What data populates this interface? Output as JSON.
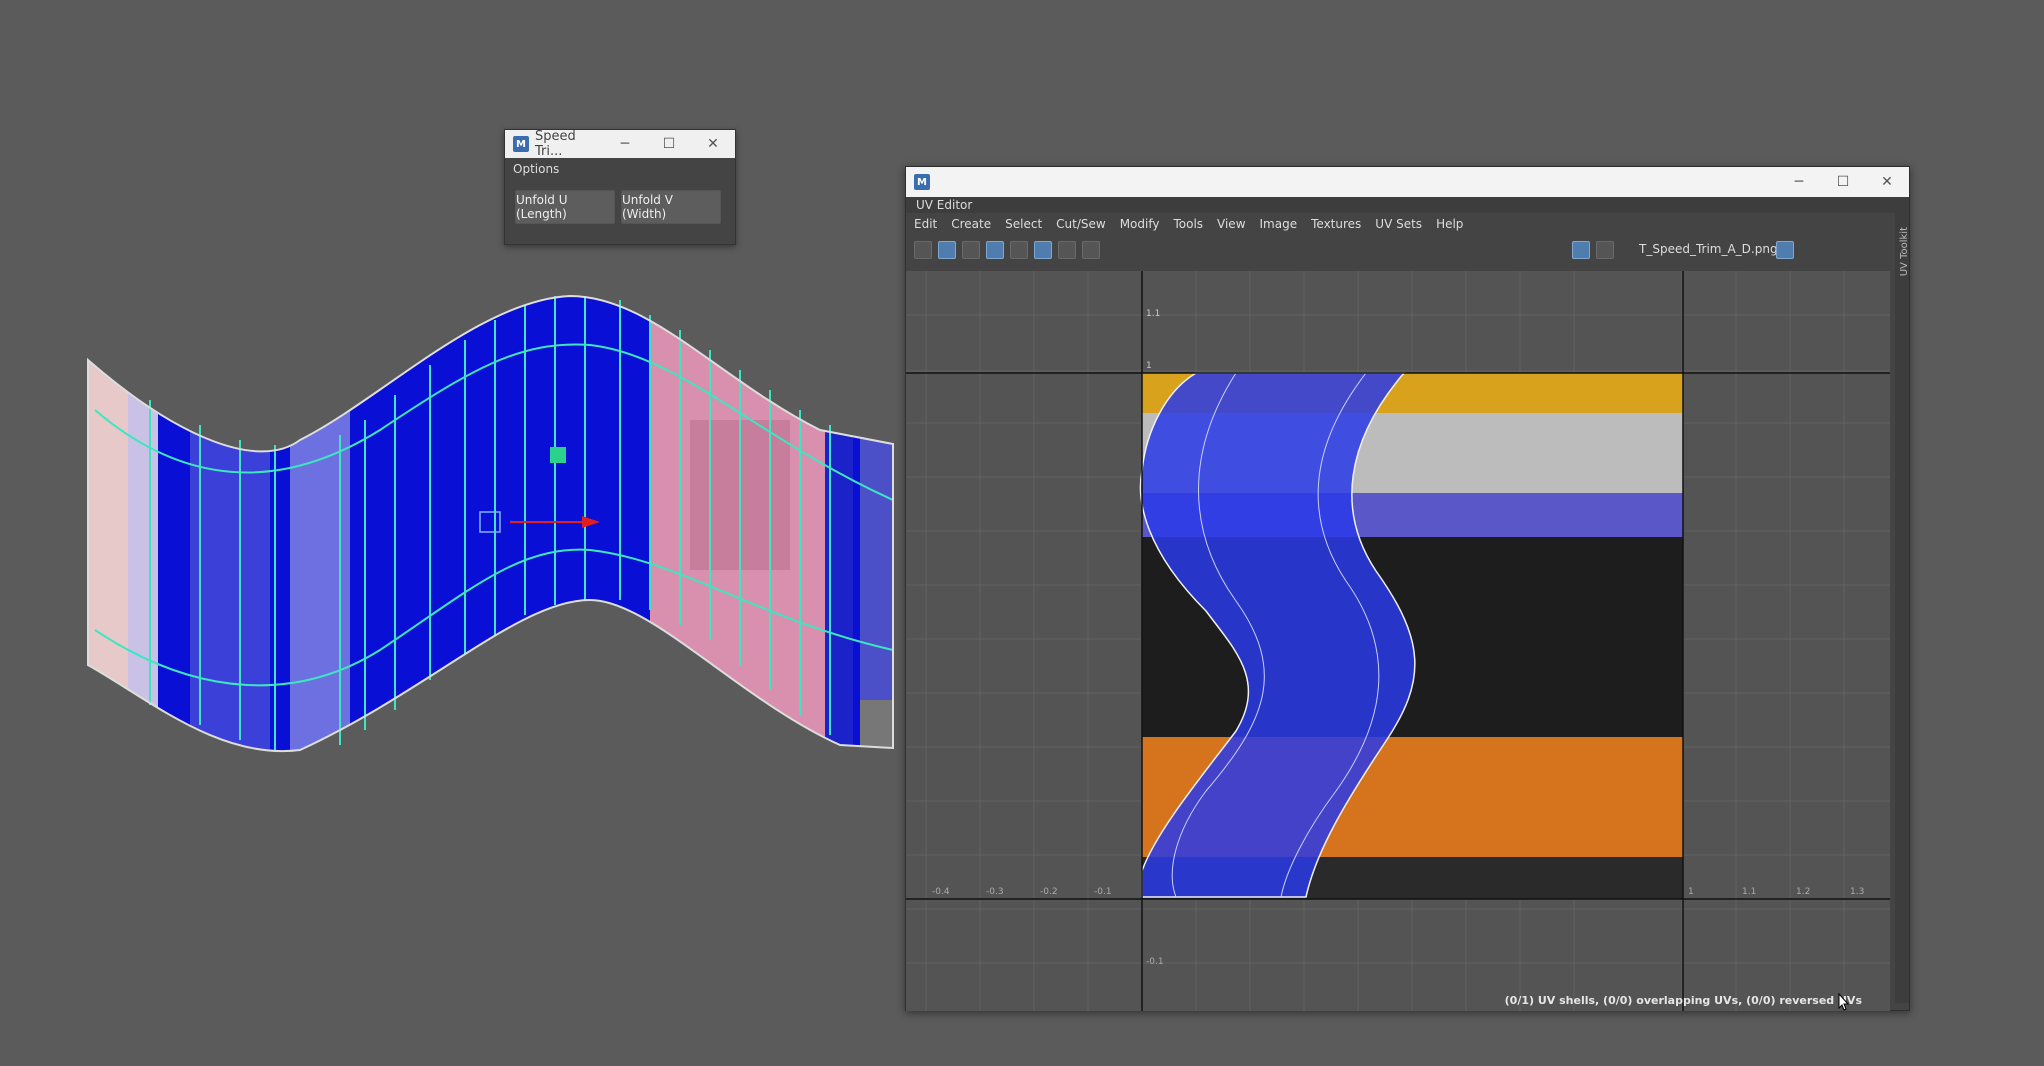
{
  "speed_window": {
    "title": "Speed Tri...",
    "options_label": "Options",
    "buttons": [
      "Unfold U (Length)",
      "Unfold V (Width)"
    ],
    "minimize": "─",
    "maximize": "☐",
    "close": "✕"
  },
  "uv_editor": {
    "tab_label": "UV Editor",
    "menu": [
      "Edit",
      "Create",
      "Select",
      "Cut/Sew",
      "Modify",
      "Tools",
      "View",
      "Image",
      "Textures",
      "UV Sets",
      "Help"
    ],
    "texture_name": "T_Speed_Trim_A_D.png",
    "side_label": "UV Toolkit",
    "status": "(0/1) UV shells, (0/0) overlapping UVs, (0/0) reversed UVs",
    "axis_labels_top": [
      "1.1",
      "1"
    ],
    "axis_labels_bottom": [
      "-0.4",
      "-0.3",
      "-0.2",
      "-0.1",
      "1",
      "1.1",
      "1.2",
      "1.3"
    ],
    "axis_label_lower": "-0.1",
    "minimize": "─",
    "maximize": "☐",
    "close": "✕"
  },
  "colors": {
    "background": "#5b5b5b",
    "mesh_blue": "#0a0fd6",
    "mesh_pink": "#d98fae",
    "wire_cyan": "#3ee6c0",
    "accent_green": "#2ad28c",
    "tex_yellow": "#d8a21c",
    "tex_orange": "#d6741e",
    "tex_gray": "#bcbcbc"
  },
  "icons": {
    "app": "maya-logo-icon",
    "manipulator": "move-manipulator-icon"
  }
}
